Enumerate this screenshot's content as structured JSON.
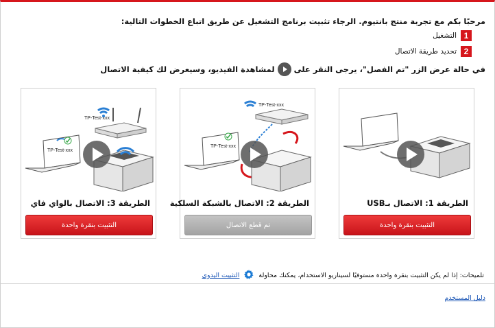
{
  "header": {
    "welcome": "مرحبًا بكم مع تجربة منتج بانتيوم. الرجاء تثبيت برنامج التشغيل عن طريق اتباع الخطوات التالية:",
    "steps": [
      {
        "number": "1",
        "label": "التشغيل"
      },
      {
        "number": "2",
        "label": "تحديد طريقة الاتصال"
      }
    ],
    "hint_before": "في حالة عرض الزر \"تم الفصل\"، يرجى النقر على",
    "hint_after": "لمشاهدة الفيديو، وسيعرض لك كيفية الاتصال"
  },
  "methods": [
    {
      "title": "الطريقة 1: الاتصال بـUSB",
      "button": "التثبيت بنقرة واحدة",
      "button_state": "enabled"
    },
    {
      "title": "الطريقة 2: الاتصال بالشبكة السلكية",
      "button": "تم قطع الاتصال",
      "button_state": "disabled",
      "router_label": "TP-Test-xxx",
      "laptop_label": "TP-Test-xxx"
    },
    {
      "title": "الطريقة 3: الاتصال بالواي فاي",
      "button": "التثبيت بنقرة واحدة",
      "button_state": "enabled",
      "router_label": "TP-Test-xxx",
      "laptop_label": "TP-Test-xxx"
    }
  ],
  "tips": {
    "text": "تلميحات: إذا لم يكن التثبيت بنقرة واحدة مستوفيًا لسيناريو الاستخدام، يمكنك محاولة",
    "link": "التثبيت اليدوي",
    "icon": "gear-icon"
  },
  "footer": {
    "manual_link": "دليل المستخدم"
  },
  "colors": {
    "accent": "#d6161c",
    "link": "#1a55b5",
    "disabled": "#a3a3a3",
    "wifi": "#2a7fd4"
  }
}
